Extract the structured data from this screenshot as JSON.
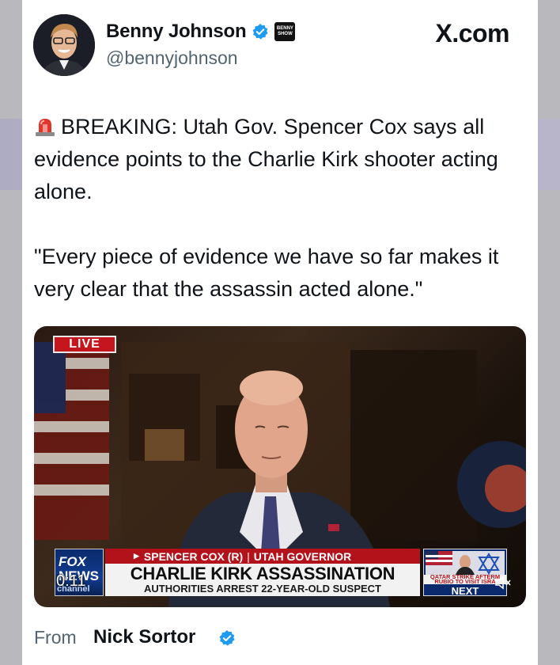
{
  "author": {
    "name": "Benny Johnson",
    "handle": "@bennyjohnson",
    "affiliate_badge": "BENNY SHOW"
  },
  "site": "X.com",
  "tweet": {
    "paragraph1": "BREAKING: Utah Gov. Spencer Cox says all evidence points to the Charlie Kirk shooter acting alone.",
    "paragraph2": "\"Every piece of evidence we have so far makes it very clear that the assassin acted alone.\""
  },
  "video": {
    "live_label": "LIVE",
    "timestamp": "0:11",
    "network": {
      "line1": "FOX",
      "line2": "NEWS",
      "line3": "channel"
    },
    "ribbon": {
      "name": "SPENCER COX (R)",
      "separator": "|",
      "title": "UTAH GOVERNOR"
    },
    "headline": "CHARLIE KIRK ASSASSINATION",
    "subhead": "AUTHORITIES ARREST 22-YEAR-OLD SUSPECT",
    "next": {
      "teaser": "QATAR STRIKE AFTERM RUBIO TO VISIT ISRA",
      "label": "NEXT"
    }
  },
  "source": {
    "prefix": "From",
    "name": "Nick Sortor"
  },
  "colors": {
    "verified_blue": "#1d9bf0",
    "fox_red": "#b3121b",
    "fox_blue": "#0b2a6e",
    "secondary_text": "#536471"
  }
}
